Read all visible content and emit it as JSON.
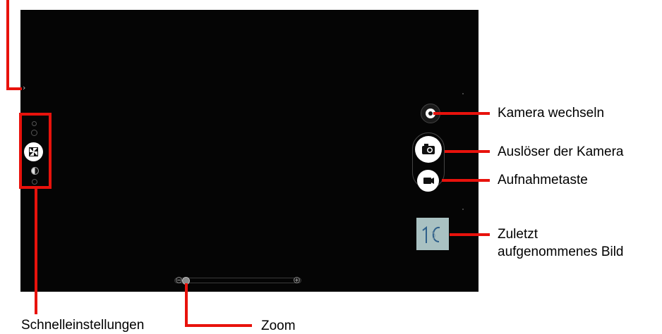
{
  "labels": {
    "switch_camera": "Kamera wechseln",
    "shutter": "Auslöser der Kamera",
    "record": "Aufnahmetaste",
    "last_photo_line1": "Zuletzt",
    "last_photo_line2": "aufgenommenes Bild",
    "quick_settings": "Schnelleinstellungen",
    "zoom": "Zoom"
  },
  "ui": {
    "side_chevron": "›",
    "zoom_minus": "−",
    "zoom_plus": "+",
    "thumbnail_text": "1C"
  },
  "zoom_level": 0.06,
  "colors": {
    "annotation": "#e8120c",
    "screen": "#050505"
  },
  "icons": [
    "switch-camera-icon",
    "camera-icon",
    "video-camera-icon",
    "focus-icon",
    "exposure-icon",
    "scene-mode-icon"
  ]
}
